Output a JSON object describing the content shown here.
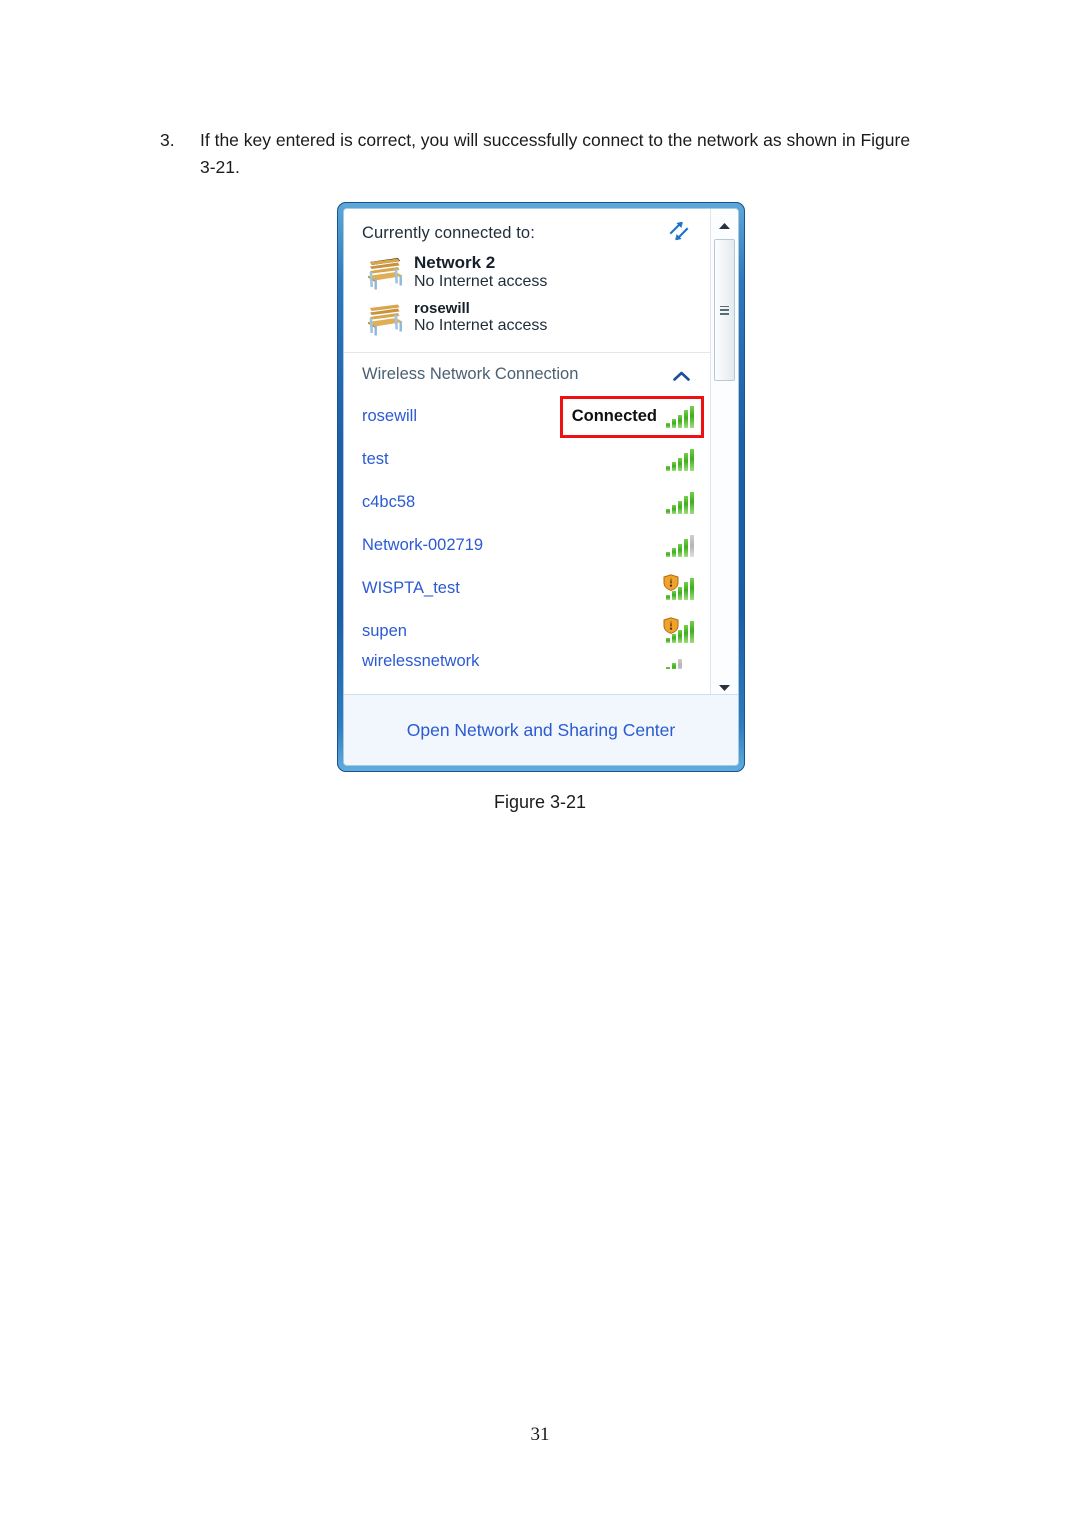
{
  "document": {
    "step_number": "3.",
    "step_text": "If the key entered is correct, you will successfully connect to the network as shown in Figure 3-21.",
    "figure_caption": "Figure 3-21",
    "page_number": "31"
  },
  "flyout": {
    "connected_section": {
      "heading": "Currently connected to:",
      "refresh_icon": "refresh-icon",
      "entries": [
        {
          "icon": "bench-icon",
          "name": "Network  2",
          "status": "No Internet access",
          "emphasis": "strong"
        },
        {
          "icon": "bench-icon",
          "name": "rosewill",
          "status": "No Internet access",
          "emphasis": "normal"
        }
      ]
    },
    "wireless_section": {
      "title": "Wireless Network Connection",
      "collapse_icon": "chevron-up-icon",
      "networks": [
        {
          "name": "rosewill",
          "status": "Connected",
          "bars_on": 5,
          "bars_total": 5,
          "secured_warning": false,
          "highlighted": true
        },
        {
          "name": "test",
          "status": "",
          "bars_on": 5,
          "bars_total": 5,
          "secured_warning": false,
          "highlighted": false
        },
        {
          "name": "c4bc58",
          "status": "",
          "bars_on": 5,
          "bars_total": 5,
          "secured_warning": false,
          "highlighted": false
        },
        {
          "name": "Network-002719",
          "status": "",
          "bars_on": 4,
          "bars_total": 5,
          "secured_warning": false,
          "highlighted": false
        },
        {
          "name": "WISPTA_test",
          "status": "",
          "bars_on": 5,
          "bars_total": 5,
          "secured_warning": true,
          "highlighted": false
        },
        {
          "name": "supen",
          "status": "",
          "bars_on": 5,
          "bars_total": 5,
          "secured_warning": true,
          "highlighted": false
        },
        {
          "name": "wirelessnetwork",
          "status": "",
          "bars_on": 2,
          "bars_total": 3,
          "secured_warning": false,
          "highlighted": false,
          "clipped": true
        }
      ]
    },
    "footer": {
      "link_label": "Open Network and Sharing Center"
    },
    "scrollbar": {
      "up_icon": "scroll-up-arrow-icon",
      "down_icon": "scroll-down-arrow-icon",
      "thumb_icon": "scrollbar-thumb"
    }
  },
  "colors": {
    "link_blue": "#2b5ad2",
    "frame_blue": "#1f5fa6",
    "annotation_red": "#ee1111",
    "signal_green": "#3fae1e",
    "signal_gray": "#b4b4b4",
    "footer_bg": "#f1f7fc"
  }
}
